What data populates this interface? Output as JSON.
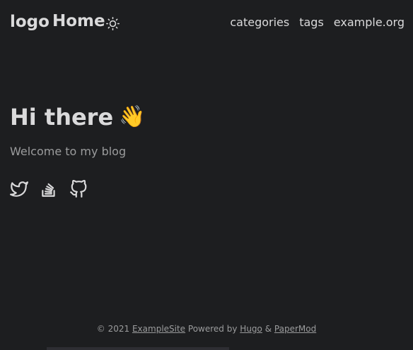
{
  "header": {
    "logo_text": "logo",
    "home_label": "Home",
    "theme_toggle_icon": "sun-icon",
    "nav": [
      {
        "label": "categories"
      },
      {
        "label": "tags"
      },
      {
        "label": "example.org"
      }
    ]
  },
  "hero": {
    "title": "Hi there",
    "emoji": "👋",
    "subtitle": "Welcome to my blog"
  },
  "social": [
    {
      "name": "twitter-icon"
    },
    {
      "name": "stackoverflow-icon"
    },
    {
      "name": "github-icon"
    }
  ],
  "footer": {
    "copyright": "© 2021",
    "site_link": "ExampleSite",
    "powered_by": "Powered by",
    "hugo_link": "Hugo",
    "amp": "&",
    "theme_link": "PaperMod"
  },
  "colors": {
    "background": "#1d1e20",
    "primary_text": "#dadadb",
    "secondary_text": "#9b9c9d"
  }
}
